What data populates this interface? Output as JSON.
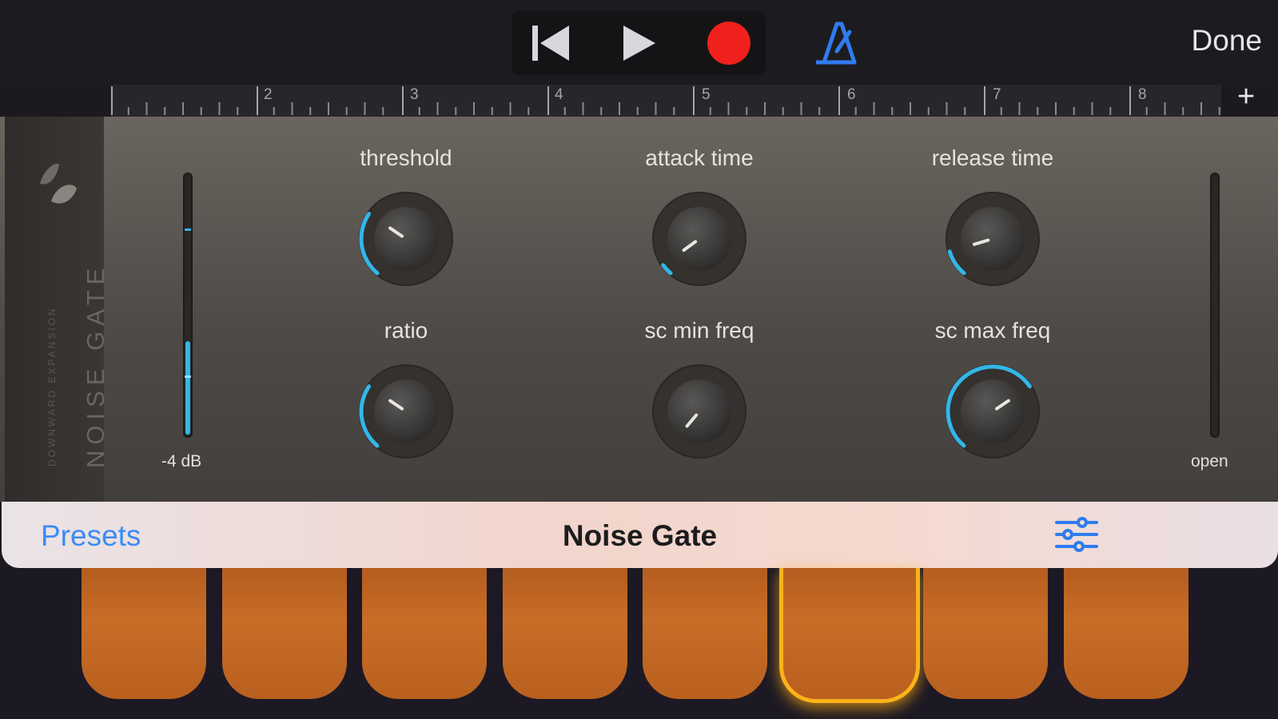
{
  "transport": {
    "rewind_icon": "skip-back-icon",
    "play_icon": "play-icon",
    "record_icon": "record-icon",
    "metronome_icon": "metronome-icon",
    "record_color": "#f0201c",
    "accent_color": "#2f7cf0"
  },
  "done_label": "Done",
  "ruler": {
    "bars": [
      "2",
      "3",
      "4",
      "5",
      "6",
      "7",
      "8"
    ],
    "plus_label": "+"
  },
  "plugin": {
    "vertical_title": "NOISE GATE",
    "vertical_subtitle": "DOWNWARD EXPANSION",
    "input_meter": {
      "label": "-4 dB",
      "level": 0.36
    },
    "output_meter": {
      "label": "open",
      "level": 0
    },
    "knobs": [
      {
        "label": "threshold",
        "value": 0.3
      },
      {
        "label": "attack time",
        "value": 0.05
      },
      {
        "label": "release time",
        "value": 0.12
      },
      {
        "label": "ratio",
        "value": 0.3
      },
      {
        "label": "sc min freq",
        "value": 0.0
      },
      {
        "label": "sc max freq",
        "value": 0.7
      }
    ],
    "knob_accent": "#33b7e8"
  },
  "preset_bar": {
    "presets_label": "Presets",
    "title": "Noise Gate",
    "controls_icon": "sliders-icon"
  },
  "pads": {
    "count": 8,
    "active_index": 5,
    "active_color": "#ffb21a"
  }
}
